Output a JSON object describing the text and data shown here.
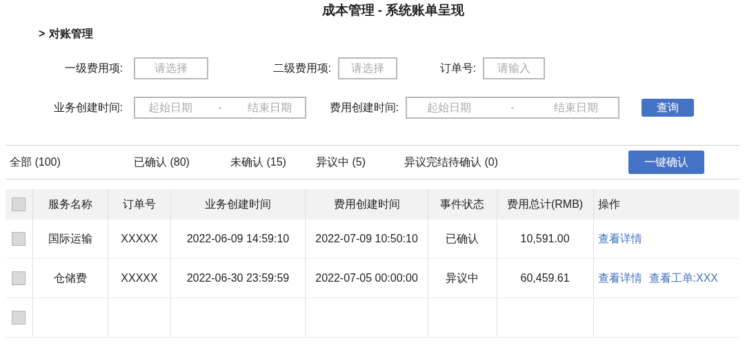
{
  "title": "成本管理 - 系统账单呈现",
  "section": {
    "marker": ">",
    "label": "对账管理"
  },
  "filters_row_1": [
    {
      "label": "一级费用项:",
      "placeholder": "请选择"
    },
    {
      "label": "二级费用项:",
      "placeholder": "请选择"
    },
    {
      "label": "订单号:",
      "placeholder": "请输入"
    }
  ],
  "filters_row_2": [
    {
      "label": "业务创建时间:",
      "start_placeholder": "起始日期",
      "separator": "-",
      "end_placeholder": "结束日期"
    },
    {
      "label": "费用创建时间:",
      "start_placeholder": "起始日期",
      "separator": "-",
      "end_placeholder": "结束日期"
    }
  ],
  "query_button": "查询",
  "status_tabs": [
    "全部 (100)",
    "已确认 (80)",
    "未确认 (15)",
    "异议中 (5)",
    "异议完结待确认 (0)"
  ],
  "confirm_all_button": "一键确认",
  "table": {
    "header_checked": false,
    "columns": [
      "服务名称",
      "订单号",
      "业务创建时间",
      "费用创建时间",
      "事件状态",
      "费用总计(RMB)",
      "操作"
    ],
    "rows": [
      {
        "checked": false,
        "cells": [
          "国际运输",
          "XXXXX",
          "2022-06-09 14:59:10",
          "2022-07-09 10:50:10",
          "已确认",
          "10,591.00"
        ],
        "actions": [
          "查看详情"
        ]
      },
      {
        "checked": false,
        "cells": [
          "仓储费",
          "XXXXX",
          "2022-06-30 23:59:59",
          "2022-07-05 00:00:00",
          "异议中",
          "60,459.61"
        ],
        "actions": [
          "查看详情",
          "查看工单:XXX"
        ]
      },
      {
        "checked": false,
        "cells": [],
        "actions": []
      }
    ]
  }
}
